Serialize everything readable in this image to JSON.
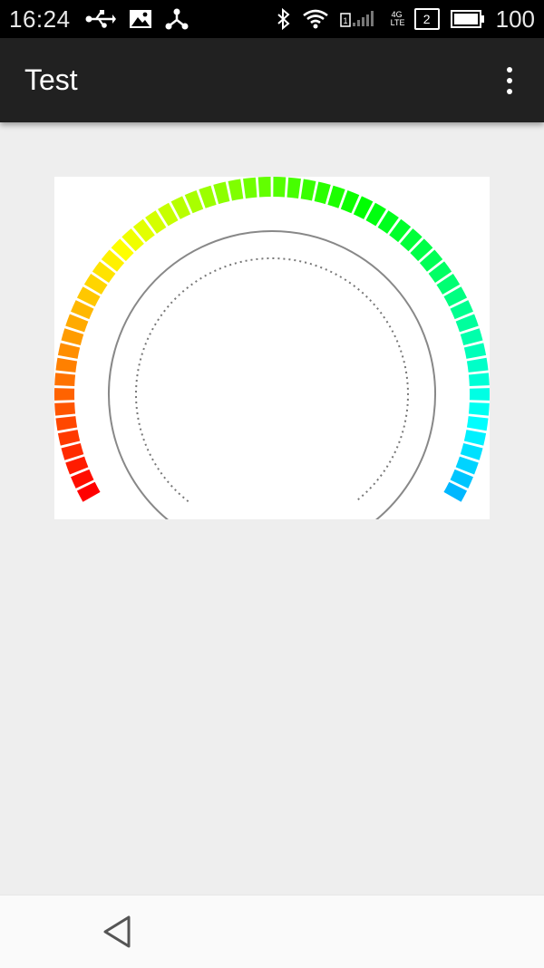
{
  "status_bar": {
    "time": "16:24",
    "battery_level": "100",
    "sim_slot": "2",
    "network_type": "4G LTE",
    "icons": [
      "usb-icon",
      "image-icon",
      "share-hub-icon",
      "bluetooth-icon",
      "wifi-icon",
      "sim-signal-icon",
      "sim2-icon",
      "battery-icon"
    ]
  },
  "app_bar": {
    "title": "Test",
    "menu_icon": "more-vert-icon"
  },
  "gauge": {
    "segments": 60,
    "sweep_degrees": 240,
    "colors": {
      "start": "#ff0000",
      "end": "#00b4ff"
    },
    "track_color": "#808080"
  },
  "nav_bar": {
    "back_icon": "back-triangle-icon"
  }
}
